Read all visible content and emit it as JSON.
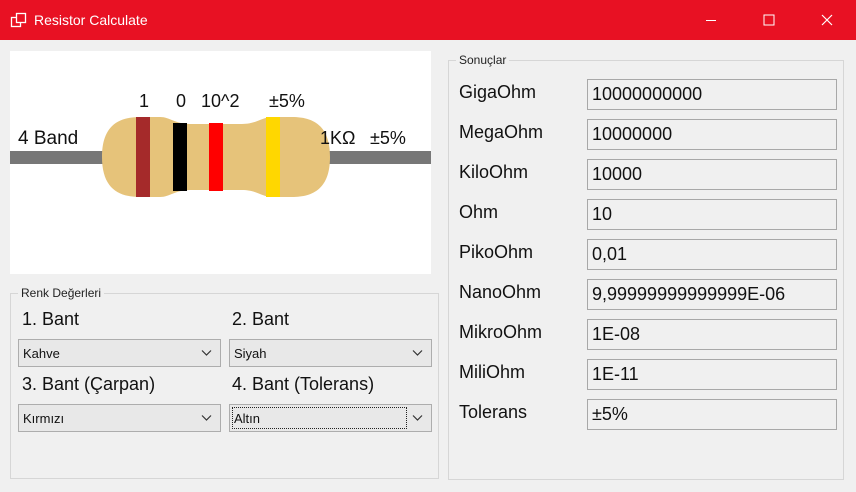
{
  "window": {
    "title": "Resistor Calculate"
  },
  "colors": {
    "titlebar": "#e81123",
    "band1": "#a52a2a",
    "band2": "#000000",
    "band3": "#ff0000",
    "band4": "#ffd700",
    "body": "#e6c37a",
    "lead": "#777777"
  },
  "resistor": {
    "band_type": "4 Band",
    "band_values": [
      "1",
      "0",
      "10^2",
      "±5%"
    ],
    "summary_value": "1KΩ",
    "summary_tolerance": "±5%"
  },
  "renk": {
    "title": "Renk Değerleri",
    "bant1_label": "1. Bant",
    "bant1_value": "Kahve",
    "bant2_label": "2. Bant",
    "bant2_value": "Siyah",
    "bant3_label": "3. Bant (Çarpan)",
    "bant3_value": "Kırmızı",
    "bant4_label": "4. Bant (Tolerans)",
    "bant4_value": "Altın"
  },
  "sonuc": {
    "title": "Sonuçlar",
    "rows": [
      {
        "label": "GigaOhm",
        "value": "10000000000"
      },
      {
        "label": "MegaOhm",
        "value": "10000000"
      },
      {
        "label": "KiloOhm",
        "value": "10000"
      },
      {
        "label": "Ohm",
        "value": "10"
      },
      {
        "label": "PikoOhm",
        "value": "0,01"
      },
      {
        "label": "NanoOhm",
        "value": "9,99999999999999E-06"
      },
      {
        "label": "MikroOhm",
        "value": "1E-08"
      },
      {
        "label": "MiliOhm",
        "value": "1E-11"
      },
      {
        "label": "Tolerans",
        "value": "±5%"
      }
    ]
  }
}
